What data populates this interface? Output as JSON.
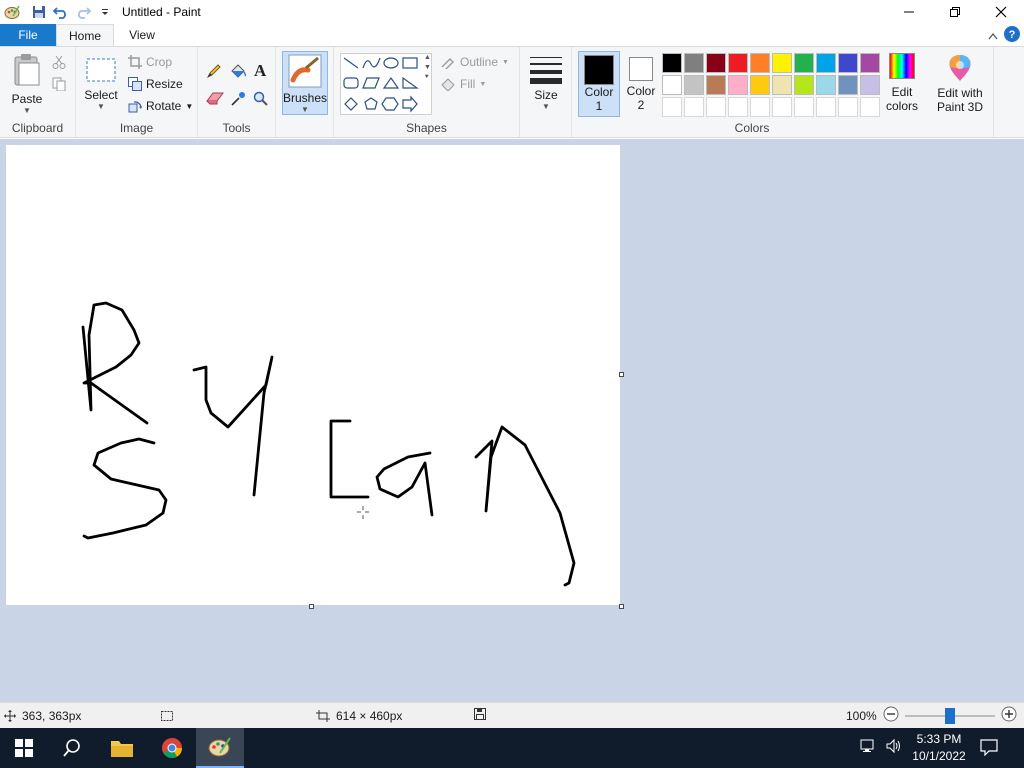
{
  "window": {
    "title": "Untitled - Paint"
  },
  "tabs": {
    "file": "File",
    "home": "Home",
    "view": "View"
  },
  "clipboard": {
    "paste": "Paste",
    "label": "Clipboard"
  },
  "image": {
    "select": "Select",
    "crop": "Crop",
    "resize": "Resize",
    "rotate": "Rotate",
    "label": "Image"
  },
  "tools": {
    "label": "Tools"
  },
  "brushes": {
    "label": "Brushes"
  },
  "shapes": {
    "outline": "Outline",
    "fill": "Fill",
    "label": "Shapes"
  },
  "size": {
    "label": "Size"
  },
  "colors": {
    "color1": "Color",
    "color1_num": "1",
    "color2": "Color",
    "color2_num": "2",
    "edit_colors_1": "Edit",
    "edit_colors_2": "colors",
    "paint3d_1": "Edit with",
    "paint3d_2": "Paint 3D",
    "label": "Colors",
    "palette_row1": [
      "#000000",
      "#7f7f7f",
      "#880015",
      "#ed1c24",
      "#ff7f27",
      "#fff200",
      "#22b14c",
      "#00a2e8",
      "#3f48cc",
      "#a349a4"
    ],
    "palette_row2": [
      "#ffffff",
      "#c3c3c3",
      "#b97a57",
      "#ffaec9",
      "#ffc90e",
      "#efe4b0",
      "#b5e61d",
      "#99d9ea",
      "#7092be",
      "#c8bfe7"
    ],
    "primary": "#000000",
    "secondary": "#ffffff"
  },
  "status": {
    "cursor_pos": "363, 363px",
    "selection_size": "",
    "image_size": "614 × 460px",
    "zoom": "100%"
  },
  "taskbar": {
    "time": "5:33 PM",
    "date": "10/1/2022"
  }
}
